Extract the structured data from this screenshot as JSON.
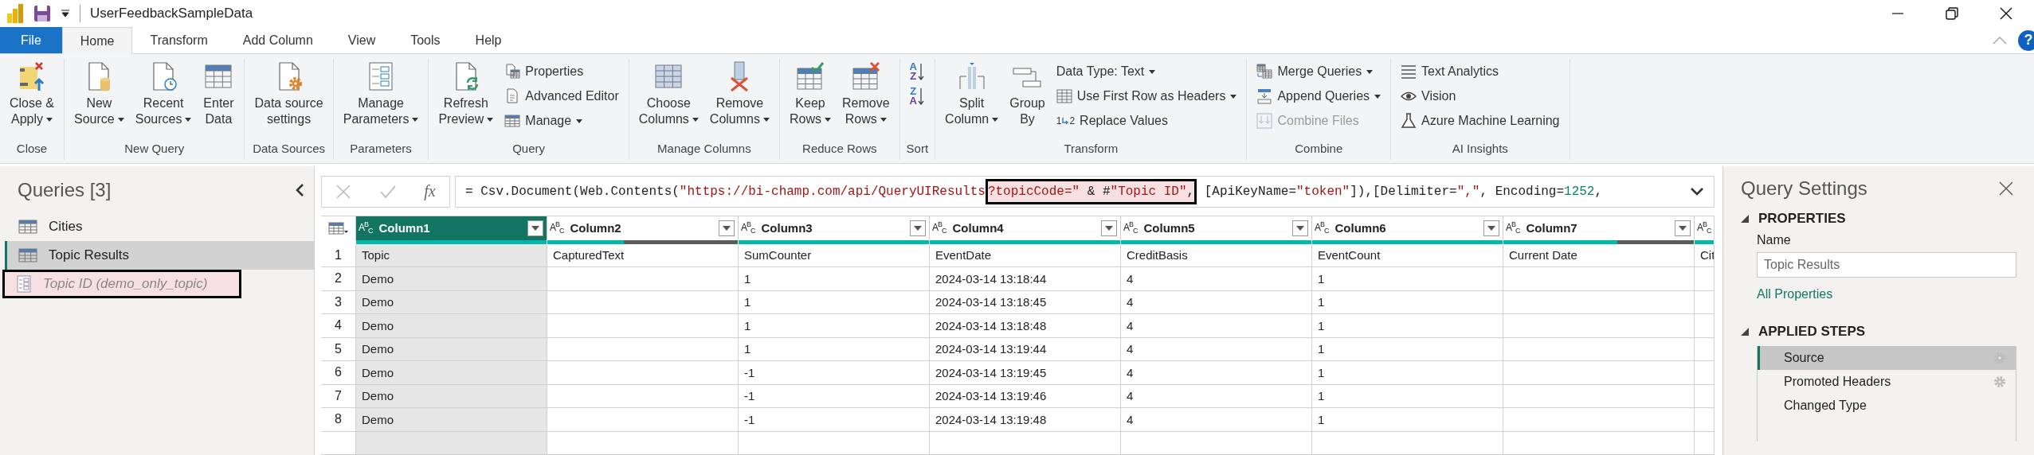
{
  "window": {
    "title": "UserFeedbackSampleData"
  },
  "tabs": [
    {
      "label": "File",
      "kind": "file",
      "selected": false
    },
    {
      "label": "Home",
      "kind": "tab",
      "selected": true
    },
    {
      "label": "Transform",
      "kind": "tab",
      "selected": false
    },
    {
      "label": "Add Column",
      "kind": "tab",
      "selected": false
    },
    {
      "label": "View",
      "kind": "tab",
      "selected": false
    },
    {
      "label": "Tools",
      "kind": "tab",
      "selected": false
    },
    {
      "label": "Help",
      "kind": "tab",
      "selected": false
    }
  ],
  "help_glyph": "?",
  "ribbon": [
    {
      "label": "Close",
      "items": [
        {
          "kind": "large",
          "lines": [
            "Close &",
            "Apply"
          ],
          "dropdown": true,
          "disabled": false
        }
      ]
    },
    {
      "label": "New Query",
      "items": [
        {
          "kind": "large",
          "lines": [
            "New",
            "Source"
          ],
          "dropdown": true,
          "disabled": false
        },
        {
          "kind": "large",
          "lines": [
            "Recent",
            "Sources"
          ],
          "dropdown": true,
          "disabled": false
        },
        {
          "kind": "large",
          "lines": [
            "Enter",
            "Data"
          ],
          "dropdown": false,
          "disabled": false
        }
      ]
    },
    {
      "label": "Data Sources",
      "items": [
        {
          "kind": "large",
          "lines": [
            "Data source",
            "settings"
          ],
          "dropdown": false,
          "disabled": false
        }
      ]
    },
    {
      "label": "Parameters",
      "items": [
        {
          "kind": "large",
          "lines": [
            "Manage",
            "Parameters"
          ],
          "dropdown": true,
          "disabled": false
        }
      ]
    },
    {
      "label": "Query",
      "items": [
        {
          "kind": "large",
          "lines": [
            "Refresh",
            "Preview"
          ],
          "dropdown": true,
          "disabled": false
        },
        {
          "kind": "small",
          "lines": [
            "Properties"
          ],
          "dropdown": false,
          "disabled": false
        },
        {
          "kind": "small",
          "lines": [
            "Advanced Editor"
          ],
          "dropdown": false,
          "disabled": false
        },
        {
          "kind": "small",
          "lines": [
            "Manage"
          ],
          "dropdown": true,
          "disabled": false
        }
      ]
    },
    {
      "label": "Manage Columns",
      "items": [
        {
          "kind": "large",
          "lines": [
            "Choose",
            "Columns"
          ],
          "dropdown": true,
          "disabled": false
        },
        {
          "kind": "large",
          "lines": [
            "Remove",
            "Columns"
          ],
          "dropdown": true,
          "disabled": false
        }
      ]
    },
    {
      "label": "Reduce Rows",
      "items": [
        {
          "kind": "large",
          "lines": [
            "Keep",
            "Rows"
          ],
          "dropdown": true,
          "disabled": false
        },
        {
          "kind": "large",
          "lines": [
            "Remove",
            "Rows"
          ],
          "dropdown": true,
          "disabled": false
        }
      ]
    },
    {
      "label": "Sort",
      "items": [
        {
          "kind": "sort",
          "glyphs": [
            "A",
            "Z"
          ],
          "disabled": false
        },
        {
          "kind": "sort",
          "glyphs": [
            "Z",
            "A"
          ],
          "disabled": false
        }
      ]
    },
    {
      "label": "Transform",
      "items": [
        {
          "kind": "large",
          "lines": [
            "Split",
            "Column"
          ],
          "dropdown": true,
          "disabled": false
        },
        {
          "kind": "large",
          "lines": [
            "Group",
            "By"
          ],
          "dropdown": false,
          "disabled": false
        },
        {
          "kind": "small",
          "lines": [
            "Data Type: Text"
          ],
          "dropdown": true,
          "disabled": false
        },
        {
          "kind": "small",
          "lines": [
            "Use First Row as Headers"
          ],
          "dropdown": true,
          "disabled": false
        },
        {
          "kind": "small",
          "lines": [
            "Replace Values"
          ],
          "glyphs": [
            "1",
            "2"
          ],
          "dropdown": false,
          "disabled": false
        }
      ]
    },
    {
      "label": "Combine",
      "items": [
        {
          "kind": "small",
          "lines": [
            "Merge Queries"
          ],
          "dropdown": true,
          "disabled": false
        },
        {
          "kind": "small",
          "lines": [
            "Append Queries"
          ],
          "dropdown": true,
          "disabled": false
        },
        {
          "kind": "small",
          "lines": [
            "Combine Files"
          ],
          "dropdown": false,
          "disabled": true
        }
      ]
    },
    {
      "label": "AI Insights",
      "items": [
        {
          "kind": "small",
          "lines": [
            "Text Analytics"
          ],
          "dropdown": false,
          "disabled": false
        },
        {
          "kind": "small",
          "lines": [
            "Vision"
          ],
          "dropdown": false,
          "disabled": false
        },
        {
          "kind": "small",
          "lines": [
            "Azure Machine Learning"
          ],
          "dropdown": false,
          "disabled": false
        }
      ]
    }
  ],
  "queries": {
    "title": "Queries [3]",
    "items": [
      {
        "label": "Cities",
        "kind": "table",
        "selected": false,
        "annotated": false
      },
      {
        "label": "Topic Results",
        "kind": "table",
        "selected": true,
        "annotated": false
      },
      {
        "label": "Topic ID (demo_only_topic)",
        "kind": "parameter",
        "selected": false,
        "annotated": true
      }
    ]
  },
  "formula_bar": {
    "fx_label": "fx",
    "segments": [
      {
        "text": "= Csv.Document(Web.Contents(",
        "kind": "plain",
        "highlighted": false
      },
      {
        "text": "\"https://bi-champ.com/api/QueryUIResults",
        "kind": "string",
        "highlighted": false
      },
      {
        "text": "?topicCode=\"",
        "kind": "string",
        "highlighted": true
      },
      {
        "text": " & #",
        "kind": "plain",
        "highlighted": true
      },
      {
        "text": "\"Topic ID\"",
        "kind": "string",
        "highlighted": true
      },
      {
        "text": ",",
        "kind": "plain",
        "highlighted": true
      },
      {
        "text": " [ApiKeyName=",
        "kind": "plain",
        "highlighted": false
      },
      {
        "text": "\"token\"",
        "kind": "string",
        "highlighted": false
      },
      {
        "text": "]),[Delimiter=",
        "kind": "plain",
        "highlighted": false
      },
      {
        "text": "\",\"",
        "kind": "string",
        "highlighted": false
      },
      {
        "text": ", Encoding=",
        "kind": "plain",
        "highlighted": false
      },
      {
        "text": "1252",
        "kind": "number",
        "highlighted": false
      },
      {
        "text": ",",
        "kind": "plain",
        "highlighted": false
      }
    ]
  },
  "table": {
    "columns": [
      {
        "type_glyph": "A$^{B}$$_{C}$",
        "name": "Column1",
        "selected": true,
        "level": 1
      },
      {
        "type_glyph": "A$^{B}$$_{C}$",
        "name": "Column2",
        "selected": false,
        "level": 0.4
      },
      {
        "type_glyph": "A$^{B}$$_{C}$",
        "name": "Column3",
        "selected": false,
        "level": 1
      },
      {
        "type_glyph": "A$^{B}$$_{C}$",
        "name": "Column4",
        "selected": false,
        "level": 1
      },
      {
        "type_glyph": "A$^{B}$$_{C}$",
        "name": "Column5",
        "selected": false,
        "level": 1
      },
      {
        "type_glyph": "A$^{B}$$_{C}$",
        "name": "Column6",
        "selected": false,
        "level": 1
      },
      {
        "type_glyph": "A$^{B}$$_{C}$",
        "name": "Column7",
        "selected": false,
        "level": 0.6
      },
      {
        "type_glyph": "A$^{B}$$_{C}$",
        "selected": false,
        "level": 1
      }
    ],
    "rows": [
      {
        "number": "1",
        "cells": [
          "Topic",
          "CapturedText",
          "SumCounter",
          "EventDate",
          "CreditBasis",
          "EventCount",
          "Current Date",
          "Cit"
        ]
      },
      {
        "number": "2",
        "cells": [
          "Demo",
          null,
          "1",
          "2024-03-14 13:18:44",
          "4",
          "1",
          null,
          null
        ]
      },
      {
        "number": "3",
        "cells": [
          "Demo",
          null,
          "1",
          "2024-03-14 13:18:45",
          "4",
          "1",
          null,
          null
        ]
      },
      {
        "number": "4",
        "cells": [
          "Demo",
          null,
          "1",
          "2024-03-14 13:18:48",
          "4",
          "1",
          null,
          null
        ]
      },
      {
        "number": "5",
        "cells": [
          "Demo",
          null,
          "1",
          "2024-03-14 13:19:44",
          "4",
          "1",
          null,
          null
        ]
      },
      {
        "number": "6",
        "cells": [
          "Demo",
          null,
          "-1",
          "2024-03-14 13:19:45",
          "4",
          "1",
          null,
          null
        ]
      },
      {
        "number": "7",
        "cells": [
          "Demo",
          null,
          "-1",
          "2024-03-14 13:19:46",
          "4",
          "1",
          null,
          null
        ]
      },
      {
        "number": "8",
        "cells": [
          "Demo",
          null,
          "-1",
          "2024-03-14 13:19:48",
          "4",
          "1",
          null,
          null
        ]
      }
    ]
  },
  "query_settings": {
    "title": "Query Settings",
    "properties": {
      "heading": "PROPERTIES",
      "name_label": "Name",
      "name_value": "Topic Results",
      "link": "All Properties"
    },
    "applied_steps": {
      "heading": "APPLIED STEPS",
      "steps": [
        {
          "label": "Source",
          "selected": true,
          "settings": true
        },
        {
          "label": "Promoted Headers",
          "selected": false,
          "settings": true
        },
        {
          "label": "Changed Type",
          "selected": false,
          "settings": false
        }
      ]
    }
  }
}
